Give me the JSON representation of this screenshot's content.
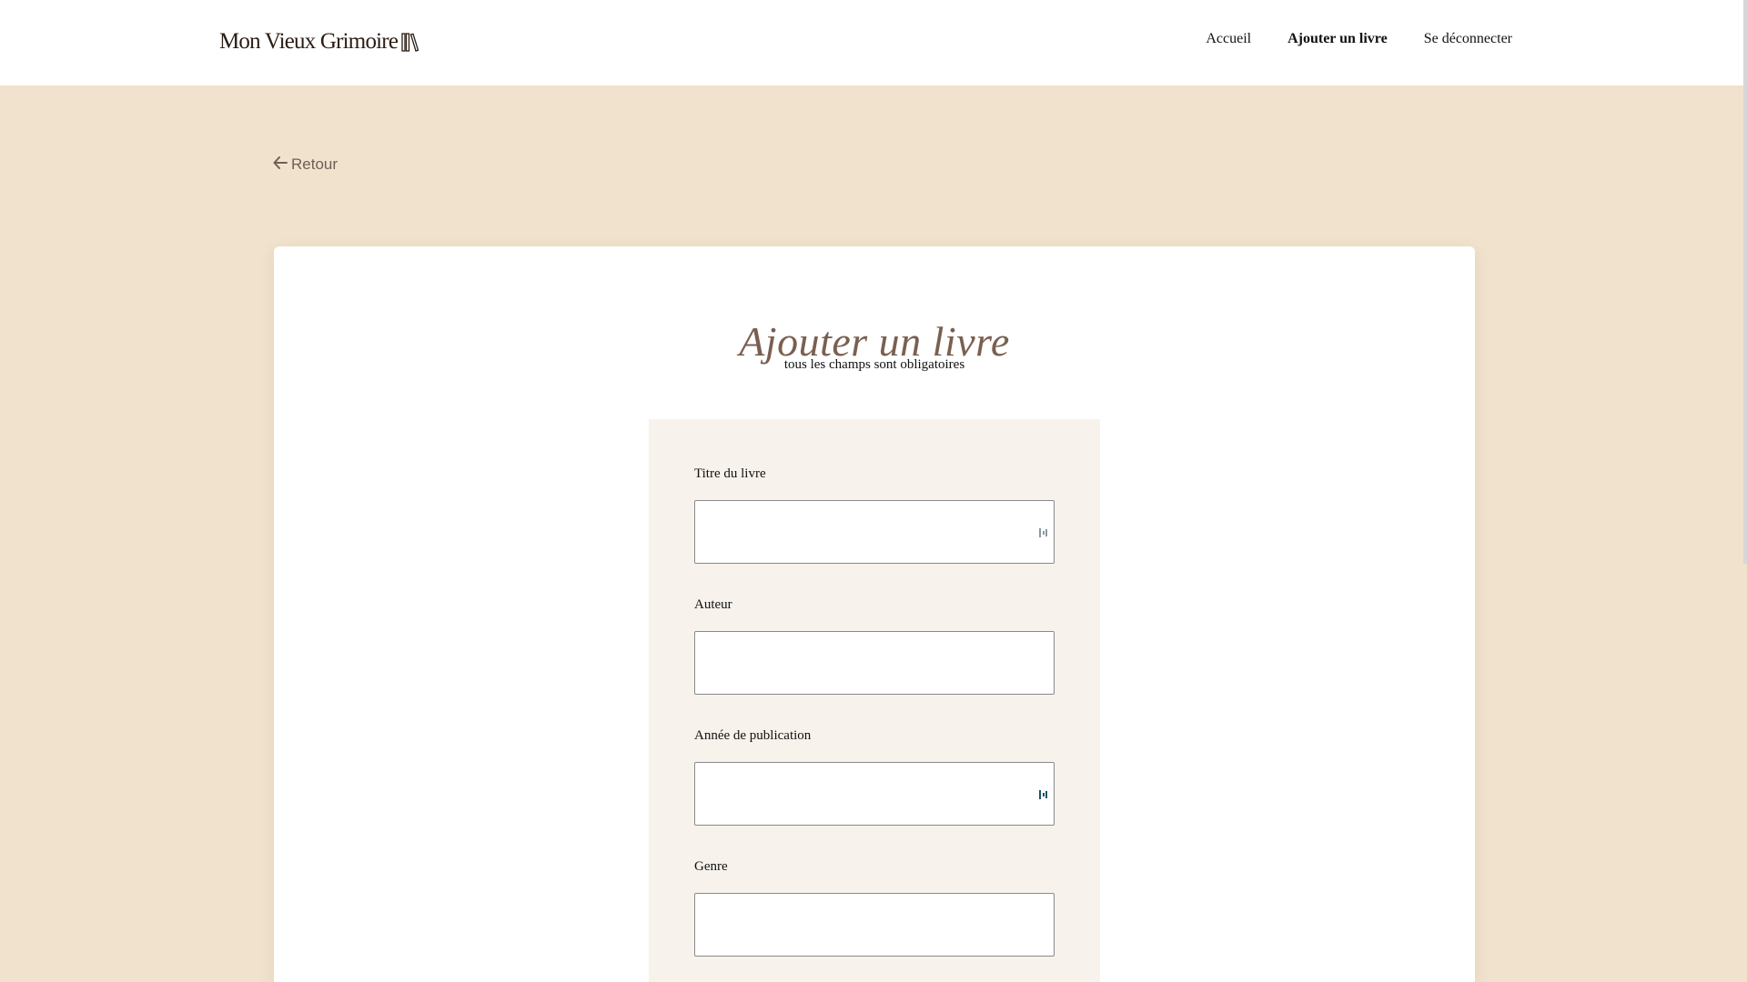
{
  "header": {
    "logo_text": "Mon Vieux Grimoire",
    "logo_icon": "books-icon",
    "nav": [
      {
        "label": "Accueil"
      },
      {
        "label": "Ajouter un livre",
        "active": true
      },
      {
        "label": "Se déconnecter"
      }
    ]
  },
  "back": {
    "icon": "arrow-left-icon",
    "label": "Retour"
  },
  "form": {
    "title": "Ajouter un livre",
    "subtitle": "tous les champs sont obligatoires",
    "fields": [
      {
        "label": "Titre du livre",
        "value": "",
        "has_extension_icon": true
      },
      {
        "label": "Auteur",
        "value": "",
        "has_extension_icon": false
      },
      {
        "label": "Année de publication",
        "value": "",
        "has_extension_icon": true
      },
      {
        "label": "Genre",
        "value": "",
        "has_extension_icon": false
      }
    ]
  },
  "colors": {
    "page_background": "#f0e2cd",
    "header_background": "#ffffff",
    "title_color": "#7a5f50",
    "form_panel_background": "#f7f2ec"
  }
}
